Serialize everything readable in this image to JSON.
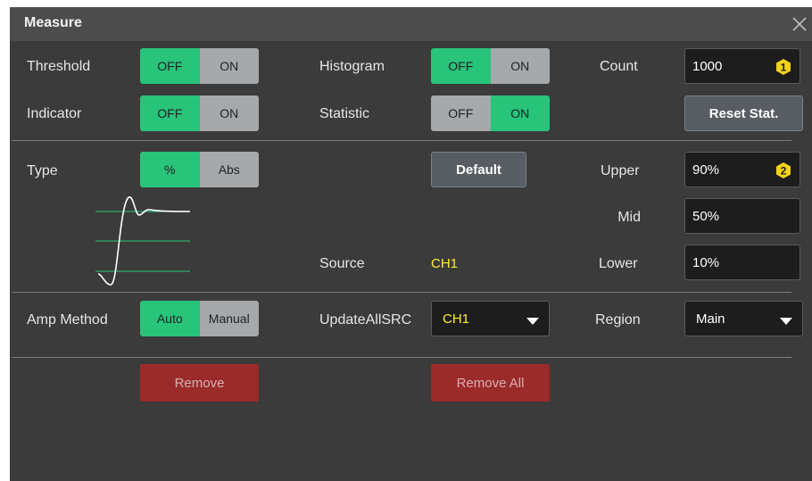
{
  "dialog": {
    "title": "Measure"
  },
  "threshold": {
    "label": "Threshold",
    "off": "OFF",
    "on": "ON",
    "value": "OFF"
  },
  "indicator": {
    "label": "Indicator",
    "off": "OFF",
    "on": "ON",
    "value": "OFF"
  },
  "histogram": {
    "label": "Histogram",
    "off": "OFF",
    "on": "ON",
    "value": "OFF"
  },
  "statistic": {
    "label": "Statistic",
    "off": "OFF",
    "on": "ON",
    "value": "ON"
  },
  "count": {
    "label": "Count",
    "value": "1000",
    "badge": "1"
  },
  "reset_stat": {
    "label": "Reset Stat."
  },
  "type": {
    "label": "Type",
    "opt1": "%",
    "opt2": "Abs",
    "value": "%"
  },
  "default_button": {
    "label": "Default"
  },
  "upper": {
    "label": "Upper",
    "value": "90%",
    "badge": "2"
  },
  "mid": {
    "label": "Mid",
    "value": "50%"
  },
  "lower": {
    "label": "Lower",
    "value": "10%"
  },
  "source": {
    "label": "Source",
    "value": "CH1"
  },
  "amp_method": {
    "label": "Amp Method",
    "opt1": "Auto",
    "opt2": "Manual",
    "value": "Auto"
  },
  "update_all_src": {
    "label": "UpdateAllSRC",
    "value": "CH1"
  },
  "region": {
    "label": "Region",
    "value": "Main"
  },
  "remove": {
    "label": "Remove"
  },
  "remove_all": {
    "label": "Remove All"
  },
  "colors": {
    "accent_green": "#27c47a",
    "toggle_off_gray": "#a5a9ab",
    "source_yellow": "#ffee33",
    "badge_yellow": "#f3d21a",
    "remove_red": "#9b2a2a"
  },
  "icons": {
    "close": "close-icon",
    "badge1": "badge-1-icon",
    "badge2": "badge-2-icon",
    "dropdown": "dropdown-arrow-icon"
  }
}
